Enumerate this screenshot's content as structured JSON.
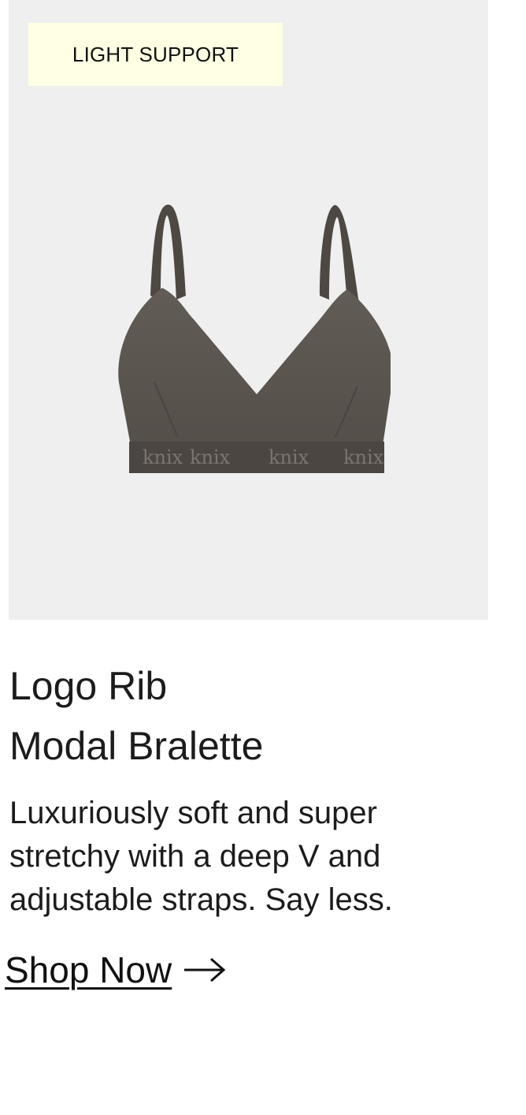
{
  "product": {
    "badge": "LIGHT SUPPORT",
    "title_line1": "Logo Rib",
    "title_line2": "Modal Bralette",
    "description": "Luxuriously soft and super stretchy with a deep V and adjustable straps. Say less.",
    "cta_label": "Shop Now",
    "image_brand_text": "knix"
  },
  "icons": {
    "cta_arrow": "arrow-right-icon"
  },
  "colors": {
    "image_background": "#efefef",
    "badge_background": "#ffffe3",
    "product_fabric": "#5b5550",
    "text": "#1c1c1c"
  }
}
